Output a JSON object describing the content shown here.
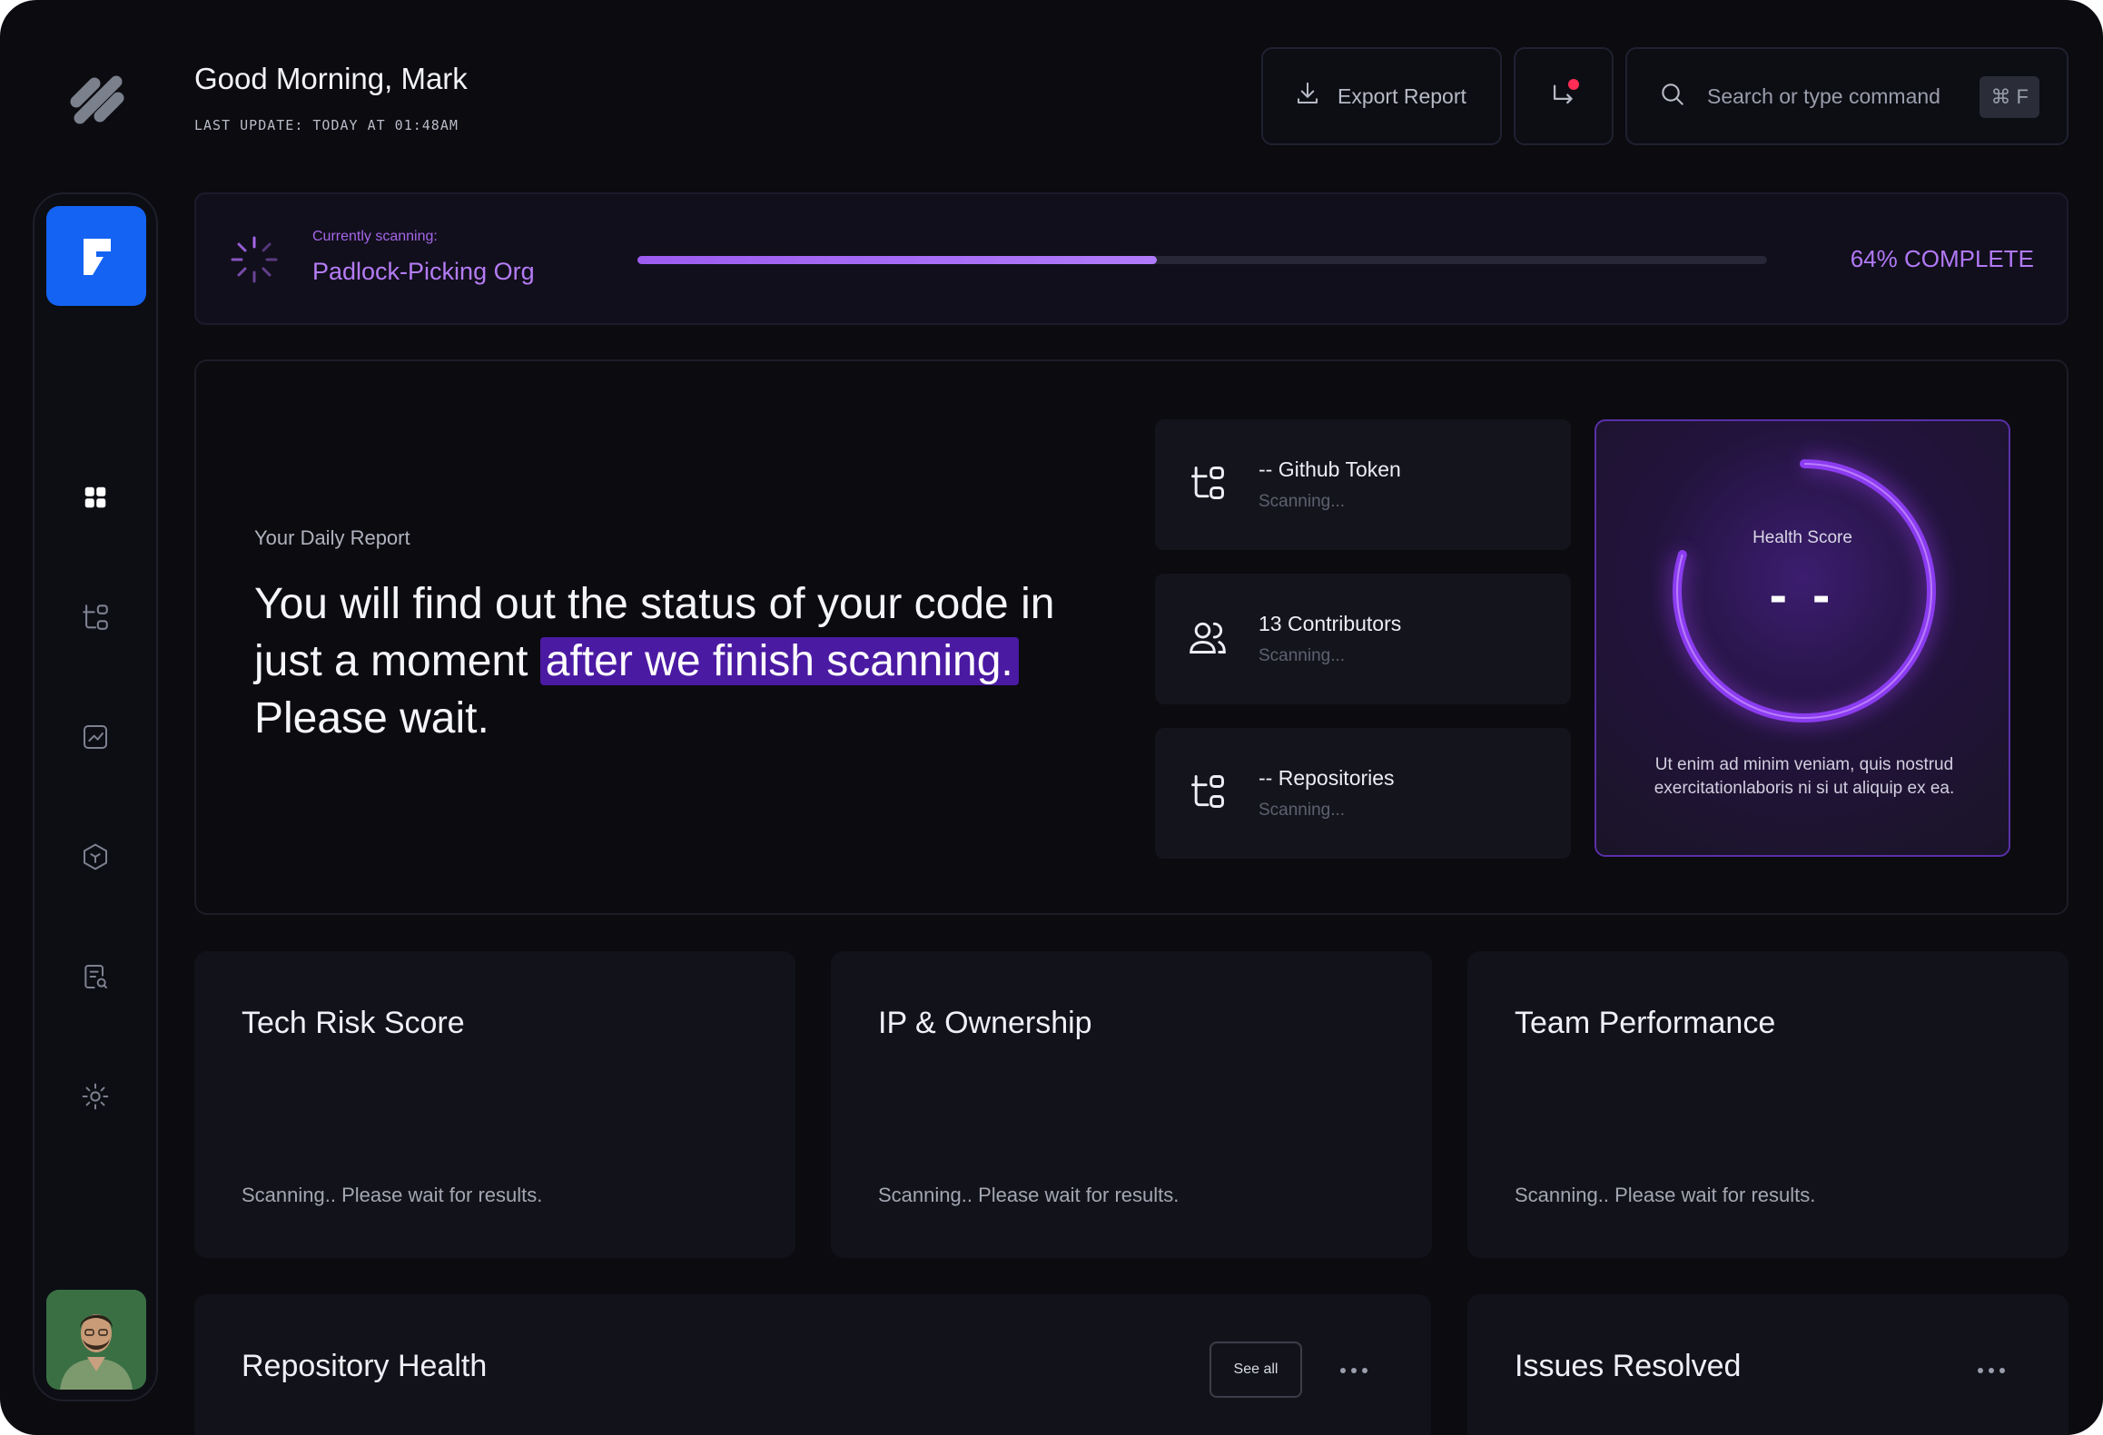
{
  "header": {
    "greeting": "Good Morning, Mark",
    "last_update": "LAST UPDATE: TODAY AT 01:48AM",
    "export_label": "Export Report",
    "search_placeholder": "Search or type command",
    "shortcut_key": "⌘ F"
  },
  "sidebar": {
    "items": [
      {
        "name": "dashboard-grid-icon",
        "active": true
      },
      {
        "name": "hierarchy-icon",
        "active": false
      },
      {
        "name": "analytics-chart-icon",
        "active": false
      },
      {
        "name": "package-cube-icon",
        "active": false
      },
      {
        "name": "document-search-icon",
        "active": false
      },
      {
        "name": "sun-settings-icon",
        "active": false
      }
    ]
  },
  "scan": {
    "label": "Currently scanning:",
    "org": "Padlock-Picking Org",
    "progress": 0.46,
    "progress_label": "64% COMPLETE"
  },
  "report": {
    "label": "Your Daily Report",
    "message_part1": "You will find out the status of your code in just a moment",
    "message_highlight": "after we finish scanning.",
    "message_part2": "Please wait.",
    "items": [
      {
        "title": "-- Github Token",
        "status": "Scanning...",
        "icon": "hierarchy-icon"
      },
      {
        "title": "13 Contributors",
        "status": "Scanning...",
        "icon": "users-icon"
      },
      {
        "title": "-- Repositories",
        "status": "Scanning...",
        "icon": "hierarchy-icon"
      }
    ]
  },
  "health": {
    "label": "Health Score",
    "value": "- -",
    "description": "Ut enim ad minim veniam, quis nostrud exercitationlaboris ni si ut aliquip ex ea."
  },
  "metrics": [
    {
      "title": "Tech Risk Score",
      "status": "Scanning.. Please wait for results."
    },
    {
      "title": "IP & Ownership",
      "status": "Scanning.. Please wait for results."
    },
    {
      "title": "Team Performance",
      "status": "Scanning.. Please wait for results."
    }
  ],
  "bottom": {
    "repo_title": "Repository Health",
    "see_all": "See all",
    "issues_title": "Issues Resolved"
  },
  "colors": {
    "accent_blue": "#1463f3",
    "accent_purple": "#b57cf5",
    "notification_dot": "#ff2d55",
    "background": "#0b0b10"
  }
}
